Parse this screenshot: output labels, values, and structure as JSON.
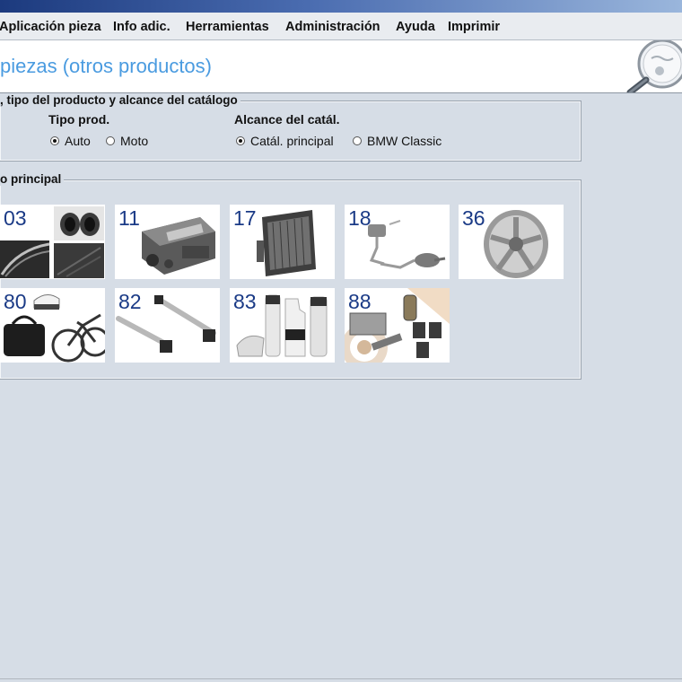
{
  "menu": {
    "items": [
      {
        "label": "Aplicación pieza"
      },
      {
        "label": "Info adic."
      },
      {
        "label": "Herramientas"
      },
      {
        "label": "Administración"
      },
      {
        "label": "Ayuda"
      },
      {
        "label": "Imprimir"
      }
    ]
  },
  "header": {
    "title": "piezas (otros productos)"
  },
  "filter_group": {
    "legend": ", tipo del producto y alcance del catálogo",
    "product_type": {
      "label": "Tipo prod.",
      "options": [
        {
          "label": "Auto",
          "selected": true
        },
        {
          "label": "Moto",
          "selected": false
        }
      ]
    },
    "catalog_scope": {
      "label": "Alcance del catál.",
      "options": [
        {
          "label": "Catál. principal",
          "selected": true
        },
        {
          "label": "BMW Classic",
          "selected": false
        }
      ]
    }
  },
  "main_group": {
    "legend": "o principal",
    "tiles": [
      {
        "number": "03",
        "icon": "body-trim-image"
      },
      {
        "number": "11",
        "icon": "engine-image"
      },
      {
        "number": "17",
        "icon": "radiator-image"
      },
      {
        "number": "18",
        "icon": "exhaust-image"
      },
      {
        "number": "36",
        "icon": "wheel-rim-image"
      },
      {
        "number": "80",
        "icon": "lifestyle-image"
      },
      {
        "number": "82",
        "icon": "roof-rack-image"
      },
      {
        "number": "83",
        "icon": "care-products-image"
      },
      {
        "number": "88",
        "icon": "service-parts-image"
      }
    ]
  }
}
